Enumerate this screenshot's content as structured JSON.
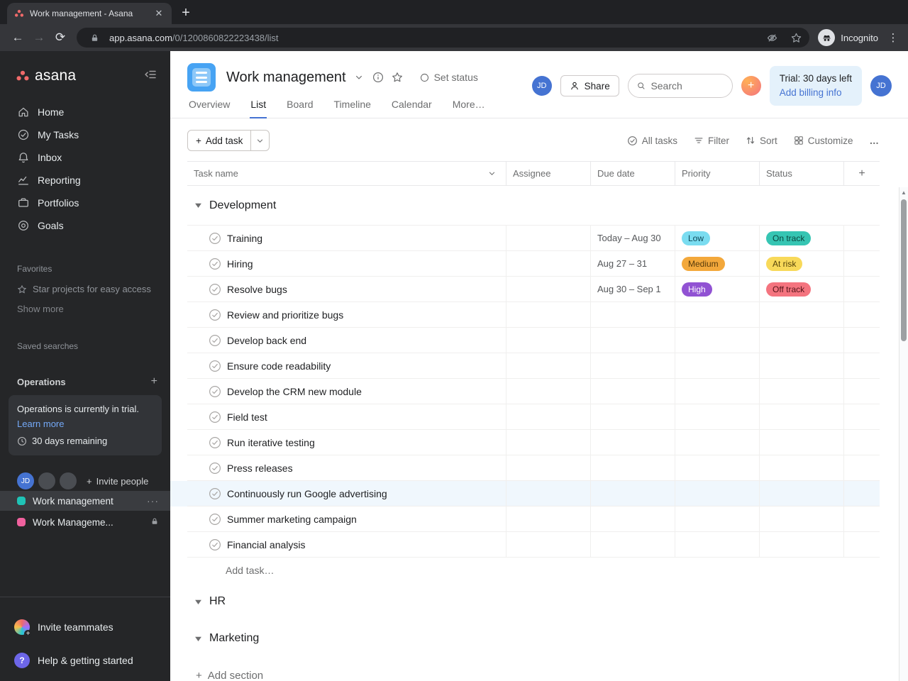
{
  "browser": {
    "tab_title": "Work management - Asana",
    "url_domain": "app.asana.com",
    "url_path": "/0/1200860822223438/list",
    "incognito_label": "Incognito"
  },
  "sidebar": {
    "logo_text": "asana",
    "nav": [
      {
        "id": "home",
        "label": "Home"
      },
      {
        "id": "my-tasks",
        "label": "My Tasks"
      },
      {
        "id": "inbox",
        "label": "Inbox"
      },
      {
        "id": "reporting",
        "label": "Reporting"
      },
      {
        "id": "portfolios",
        "label": "Portfolios"
      },
      {
        "id": "goals",
        "label": "Goals"
      }
    ],
    "favorites_label": "Favorites",
    "favorites_hint": "Star projects for easy access",
    "show_more": "Show more",
    "saved_searches_label": "Saved searches",
    "team_name": "Operations",
    "trial_card": {
      "text": "Operations is currently in trial.",
      "link": "Learn more",
      "remaining": "30 days remaining"
    },
    "avatar_initials": "JD",
    "invite_people": "Invite people",
    "projects": [
      {
        "name": "Work management",
        "color": "#1fc3b6",
        "selected": true
      },
      {
        "name": "Work Manageme...",
        "color": "#f0619e",
        "locked": true
      }
    ],
    "invite_teammates": "Invite teammates",
    "help_label": "Help & getting started"
  },
  "header": {
    "title": "Work management",
    "set_status": "Set status",
    "member_avatar": "JD",
    "share": "Share",
    "search_placeholder": "Search",
    "trial_left": "Trial: 30 days left",
    "billing_link": "Add billing info",
    "user_avatar": "JD"
  },
  "tabs": [
    {
      "label": "Overview"
    },
    {
      "label": "List",
      "active": true
    },
    {
      "label": "Board"
    },
    {
      "label": "Timeline"
    },
    {
      "label": "Calendar"
    },
    {
      "label": "More…"
    }
  ],
  "toolbar": {
    "add_task": "Add task",
    "all_tasks": "All tasks",
    "filter": "Filter",
    "sort": "Sort",
    "customize": "Customize"
  },
  "colors": {
    "accent": "#4573d2"
  },
  "table": {
    "columns": [
      "Task name",
      "Assignee",
      "Due date",
      "Priority",
      "Status"
    ],
    "sections": [
      {
        "name": "Development",
        "add_task_label": "Add task…",
        "tasks": [
          {
            "name": "Training",
            "due": "Today – Aug 30",
            "priority": {
              "label": "Low",
              "bg": "#7adcf0",
              "fg": "#0d4756"
            },
            "status": {
              "label": "On track",
              "bg": "#36c5b3",
              "fg": "#0a463e"
            }
          },
          {
            "name": "Hiring",
            "due": "Aug 27 – 31",
            "priority": {
              "label": "Medium",
              "bg": "#f3a83b",
              "fg": "#573a0b"
            },
            "status": {
              "label": "At risk",
              "bg": "#f8d959",
              "fg": "#54420a"
            }
          },
          {
            "name": "Resolve bugs",
            "due": "Aug 30 – Sep 1",
            "priority": {
              "label": "High",
              "bg": "#9152d3",
              "fg": "#ffffff"
            },
            "status": {
              "label": "Off track",
              "bg": "#f4747f",
              "fg": "#541319"
            }
          },
          {
            "name": "Review and prioritize bugs"
          },
          {
            "name": "Develop back end"
          },
          {
            "name": "Ensure code readability"
          },
          {
            "name": "Develop the CRM new module"
          },
          {
            "name": "Field test"
          },
          {
            "name": "Run iterative testing"
          },
          {
            "name": "Press releases"
          },
          {
            "name": "Continuously run Google advertising",
            "highlighted": true
          },
          {
            "name": "Summer marketing campaign"
          },
          {
            "name": "Financial analysis"
          }
        ]
      },
      {
        "name": "HR",
        "tasks": []
      },
      {
        "name": "Marketing",
        "tasks": []
      }
    ],
    "add_section": "Add section"
  }
}
